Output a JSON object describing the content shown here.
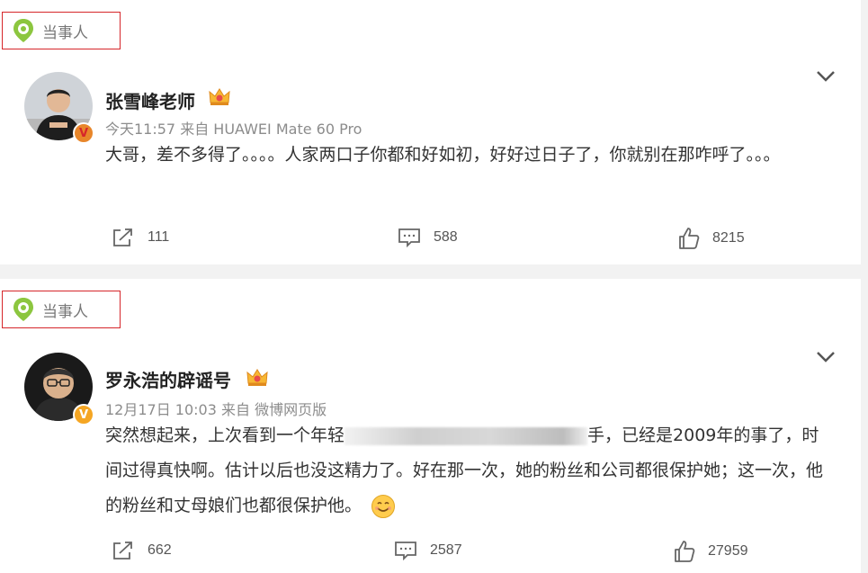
{
  "posts": [
    {
      "tag": "当事人",
      "author": "张雪峰老师",
      "verified_badge": "V",
      "meta": "今天11:57  来自 HUAWEI Mate 60 Pro",
      "text": "大哥，差不多得了。。。。人家两口子你都和好如初，好好过日子了，你就别在那咋呼了。。。",
      "reposts": "111",
      "comments": "588",
      "likes": "8215"
    },
    {
      "tag": "当事人",
      "author": "罗永浩的辟谣号",
      "verified_badge": "V",
      "meta": "12月17日 10:03  来自 微博网页版",
      "text_before_blur": "突然想起来，上次看到一个年轻",
      "text_after_blur": "手，已经是2009年的事了，时间过得真快啊。估计以后也没这精力了。好在那一次，她的粉丝和公司都很保护她；这一次，他的粉丝和丈母娘们也都很保护他。",
      "reposts": "662",
      "comments": "2587",
      "likes": "27959"
    }
  ],
  "icons": {
    "tag": "location-pin-icon",
    "menu": "chevron-down-icon",
    "member": "crown-icon",
    "repost": "repost-icon",
    "comment": "comment-icon",
    "like": "thumbs-up-icon",
    "emoji": "smile-emoji-icon"
  },
  "colors": {
    "tag_border": "#d6262a",
    "pin_green": "#8cc63f",
    "verified_gold": "#f5a623",
    "text": "#333333",
    "meta": "#8c8c8c"
  }
}
